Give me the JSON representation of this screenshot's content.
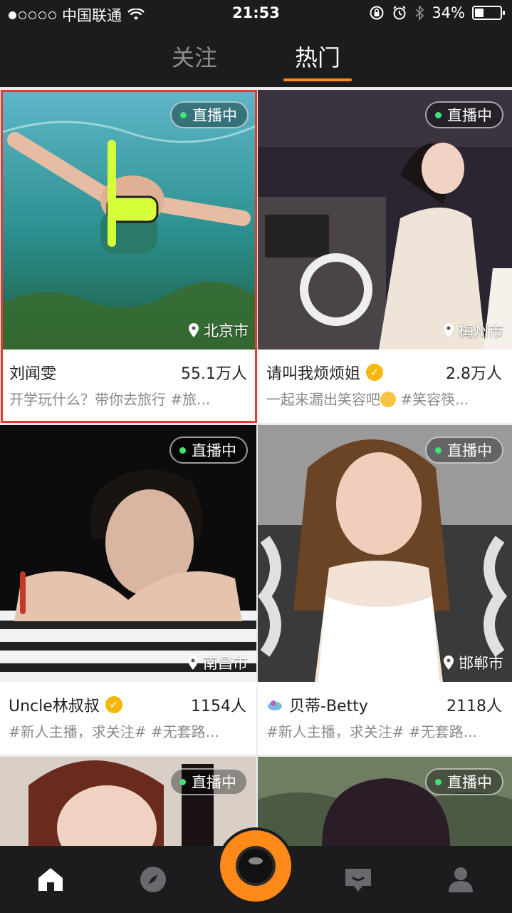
{
  "status_bar": {
    "carrier": "中国联通",
    "time": "21:53",
    "battery_percent": "34%",
    "battery_level": 0.34,
    "signal_bars": 1,
    "icons": [
      "signal-dots-icon",
      "wifi-icon",
      "rotation-lock-icon",
      "alarm-icon",
      "bluetooth-icon",
      "battery-icon"
    ]
  },
  "tabs": [
    {
      "label": "关注",
      "active": false
    },
    {
      "label": "热门",
      "active": true
    }
  ],
  "accent_color": "#ff8a1a",
  "live_label": "直播中",
  "cards": [
    {
      "name": "刘闻雯",
      "viewers": "55.1万人",
      "desc": "开学玩什么？带你去旅行 #旅...",
      "city": "北京市",
      "verified": false,
      "highlighted": true
    },
    {
      "name": "请叫我烦烦姐",
      "viewers": "2.8万人",
      "desc_before": "一起来漏出笑容吧",
      "desc_after": " #笑容筷...",
      "city": "梅州市",
      "verified": true,
      "highlighted": false
    },
    {
      "name": "Uncle林叔叔",
      "viewers": "1154人",
      "desc": "#新人主播，求关注# #无套路...",
      "city": "南昌市",
      "verified": true,
      "highlighted": false
    },
    {
      "name": "贝蒂-Betty",
      "viewers": "2118人",
      "desc": "#新人主播，求关注# #无套路...",
      "city": "邯郸市",
      "verified": false,
      "highlighted": false
    },
    {
      "name": "",
      "viewers": "",
      "desc": "",
      "city": "",
      "verified": false
    },
    {
      "name": "",
      "viewers": "",
      "desc": "",
      "city": "",
      "verified": false
    }
  ],
  "bottom_nav": [
    {
      "icon": "home-icon",
      "active": true
    },
    {
      "icon": "compass-icon",
      "active": false
    },
    {
      "icon": "live-camera-icon",
      "active": false
    },
    {
      "icon": "message-icon",
      "active": false
    },
    {
      "icon": "profile-icon",
      "active": false
    }
  ]
}
